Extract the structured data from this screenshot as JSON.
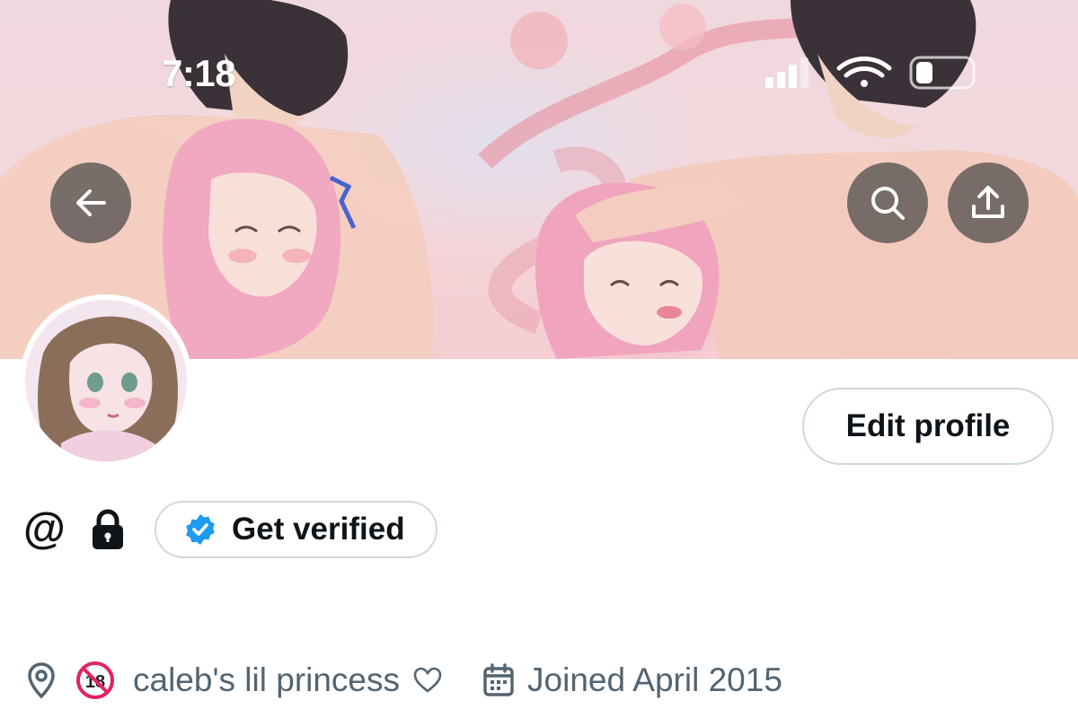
{
  "status_bar": {
    "time": "7:18",
    "icons": [
      "cellular-signal-icon",
      "wifi-icon",
      "battery-icon"
    ]
  },
  "banner": {
    "description_icon": "illustration",
    "buttons": [
      {
        "name": "back-button",
        "icon": "arrow-left-icon"
      },
      {
        "name": "search-button",
        "icon": "search-icon"
      },
      {
        "name": "share-button",
        "icon": "share-icon"
      }
    ]
  },
  "profile": {
    "edit_profile_label": "Edit profile",
    "handle_prefix": "@",
    "get_verified_label": "Get verified",
    "location": "caleb's lil princess",
    "joined": "Joined April 2015"
  },
  "colors": {
    "verified_blue": "#1d9bf0",
    "muted_text": "#536471",
    "border": "#cfd9de",
    "nsfw_red": "#e0245e"
  }
}
